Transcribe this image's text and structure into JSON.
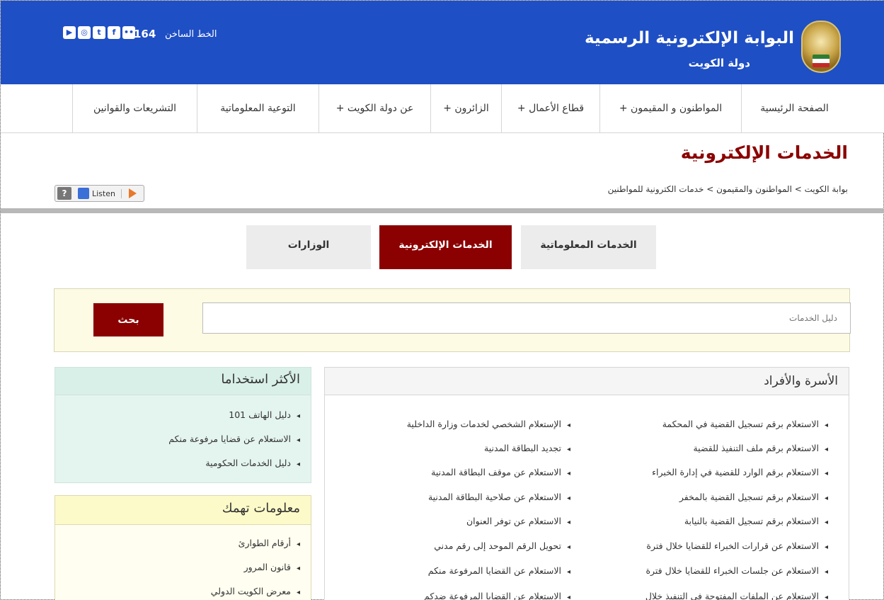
{
  "header": {
    "title": "البوابة الإلكترونية الرسمية",
    "subtitle": "دولة الكويت",
    "hotline_label": "الخط الساخن",
    "hotline_number": "164",
    "social_icons": [
      "youtube-icon",
      "instagram-icon",
      "twitter-icon",
      "facebook-icon",
      "flickr-icon"
    ]
  },
  "nav": {
    "items": [
      "الصفحة الرئيسية",
      "المواطنون و المقيمون +",
      "قطاع الأعمال +",
      "الزائرون +",
      "عن دولة الكويت +",
      "التوعية المعلوماتية",
      "التشريعات والقوانين"
    ]
  },
  "page": {
    "title": "الخدمات الإلكترونية",
    "breadcrumb": "بوابة الكويت > المواطنون والمقيمون > خدمات الكترونية للمواطنين",
    "listen_label": "Listen",
    "help_label": "?"
  },
  "tabs": [
    "الخدمات المعلوماتية",
    "الخدمات الإلكترونية",
    "الوزارات"
  ],
  "search": {
    "placeholder": "دليل الخدمات",
    "button_label": "بحث"
  },
  "family": {
    "title": "الأسرة والأفراد",
    "col_right": [
      "الاستعلام برقم تسجيل القضية في المحكمة",
      "الاستعلام برقم ملف التنفيذ للقضية",
      "الاستعلام برقم الوارد للقضية في إدارة الخبراء",
      "الاستعلام برقم تسجيل القضية بالمخفر",
      "الاستعلام برقم تسجيل القضية بالنيابة",
      "الاستعلام عن قرارات الخبراء للقضايا خلال فترة",
      "الاستعلام عن جلسات الخبراء للقضايا خلال فترة",
      "الاستعلام عن الملفات المفتوحة في التنفيذ خلال"
    ],
    "col_left": [
      "الإستعلام الشخصي لخدمات وزارة الداخلية",
      "تجديد البطاقة المدنية",
      "الاستعلام عن موقف البطاقة المدنية",
      "الاستعلام عن صلاحية البطاقة المدنية",
      "الاستعلام عن توفر العنوان",
      "تحويل الرقم الموحد إلى رقم مدني",
      "الاستعلام عن القضايا المرفوعة منكم",
      "الاستعلام عن القضايا المرفوعة ضدكم"
    ]
  },
  "most_used": {
    "title": "الأكثر استخداما",
    "items": [
      "دليل الهاتف 101",
      "الاستعلام عن قضايا مرفوعة منكم",
      "دليل الخدمات الحكومية"
    ]
  },
  "info": {
    "title": "معلومات تهمك",
    "items": [
      "أرقام الطوارئ",
      "قانون المرور",
      "معرض الكويت الدولي"
    ]
  }
}
